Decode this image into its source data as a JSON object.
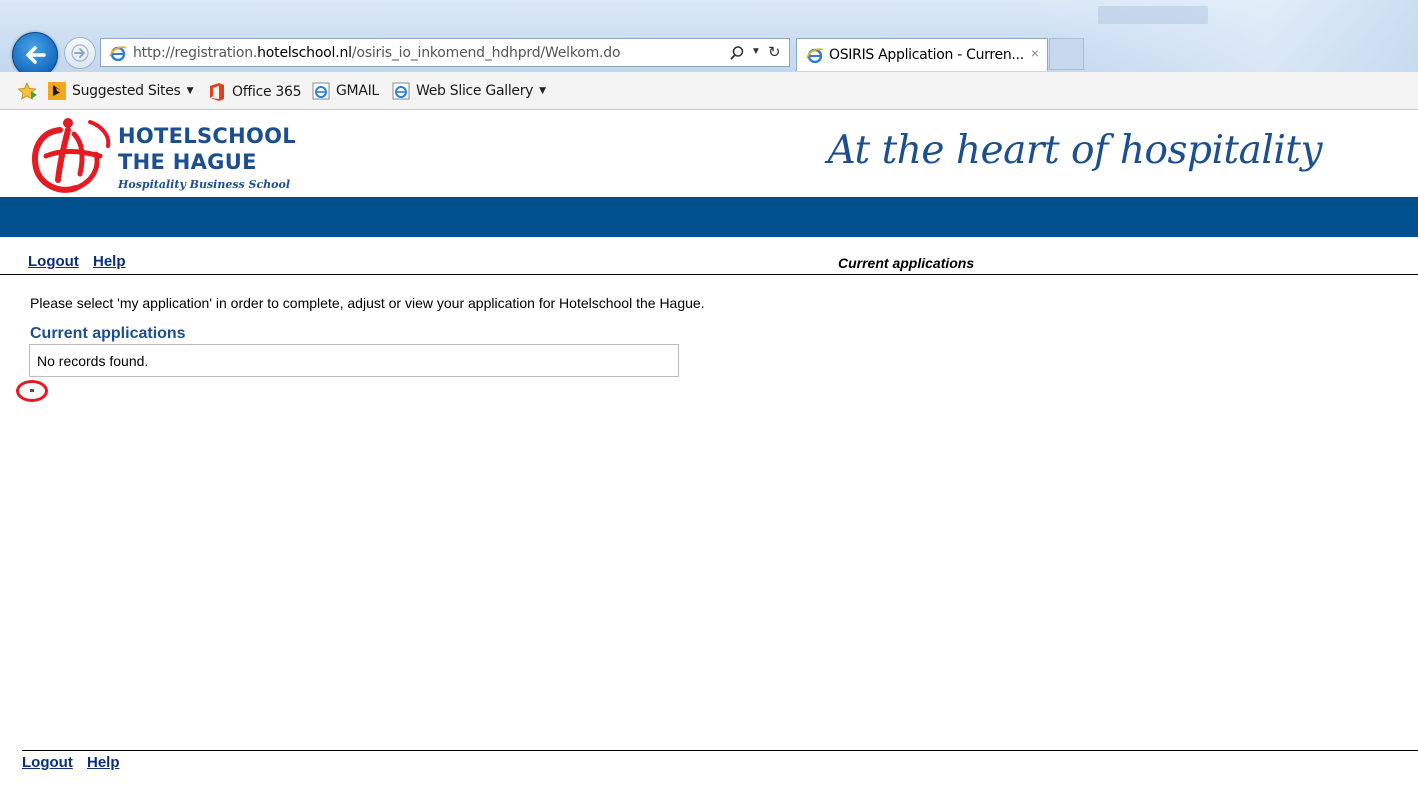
{
  "browser": {
    "url_prefix": "http://registration.",
    "url_host": "hotelschool.nl",
    "url_path": "/osiris_io_inkomend_hdhprd/Welkom.do",
    "tab_title": "OSIRIS Application - Curren...",
    "tab_close": "×",
    "favorites": [
      {
        "label": "Suggested Sites",
        "caret": "▼"
      },
      {
        "label": "Office 365"
      },
      {
        "label": "GMAIL"
      },
      {
        "label": "Web Slice Gallery",
        "caret": "▼"
      }
    ]
  },
  "header": {
    "logo_line1": "HOTELSCHOOL",
    "logo_line2": "THE HAGUE",
    "logo_line3": "Hospitality Business School",
    "tagline": "At the heart of hospitality"
  },
  "nav": {
    "logout": "Logout",
    "help": "Help",
    "current_page": "Current applications"
  },
  "main": {
    "intro": "Please select 'my application' in order to complete, adjust or view your application for Hotelschool the Hague.",
    "section_title": "Current applications",
    "empty_message": "No records found."
  },
  "footer": {
    "logout": "Logout",
    "help": "Help"
  },
  "colors": {
    "brand_blue": "#00508f",
    "link_blue": "#0b2f7a",
    "logo_red": "#e41b23"
  }
}
